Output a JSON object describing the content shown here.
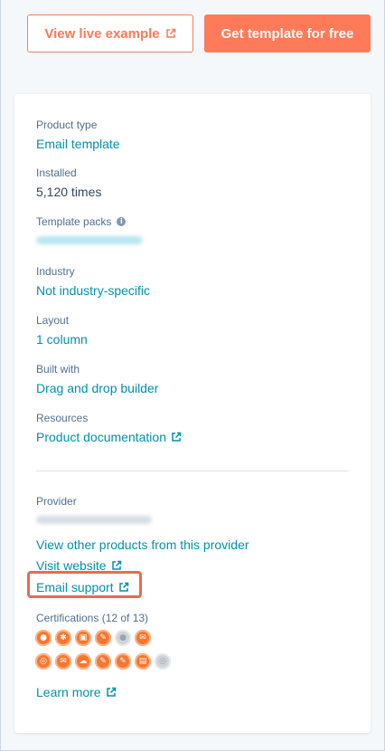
{
  "buttons": {
    "view_live": "View live example",
    "get_template": "Get template for free"
  },
  "details": {
    "product_type_label": "Product type",
    "product_type_value": "Email template",
    "installed_label": "Installed",
    "installed_value": "5,120 times",
    "template_packs_label": "Template packs",
    "industry_label": "Industry",
    "industry_value": "Not industry-specific",
    "layout_label": "Layout",
    "layout_value": "1 column",
    "built_with_label": "Built with",
    "built_with_value": "Drag and drop builder",
    "resources_label": "Resources",
    "resources_value": "Product documentation"
  },
  "provider": {
    "label": "Provider",
    "view_other": "View other products from this provider",
    "visit_website": "Visit website",
    "email_support": "Email support"
  },
  "certifications": {
    "label": "Certifications (12 of 13)",
    "learn_more": "Learn more",
    "row1": [
      "cert-icon",
      "cert-icon",
      "cert-icon",
      "cert-icon",
      "cert-icon-disabled",
      "cert-icon"
    ],
    "row2": [
      "cert-icon",
      "cert-icon",
      "cert-icon",
      "cert-icon",
      "cert-icon",
      "cert-icon",
      "cert-icon-disabled"
    ]
  },
  "colors": {
    "accent": "#ff7a59",
    "link": "#0091ae",
    "highlight": "#e96a53",
    "cert": "#f6772f"
  }
}
